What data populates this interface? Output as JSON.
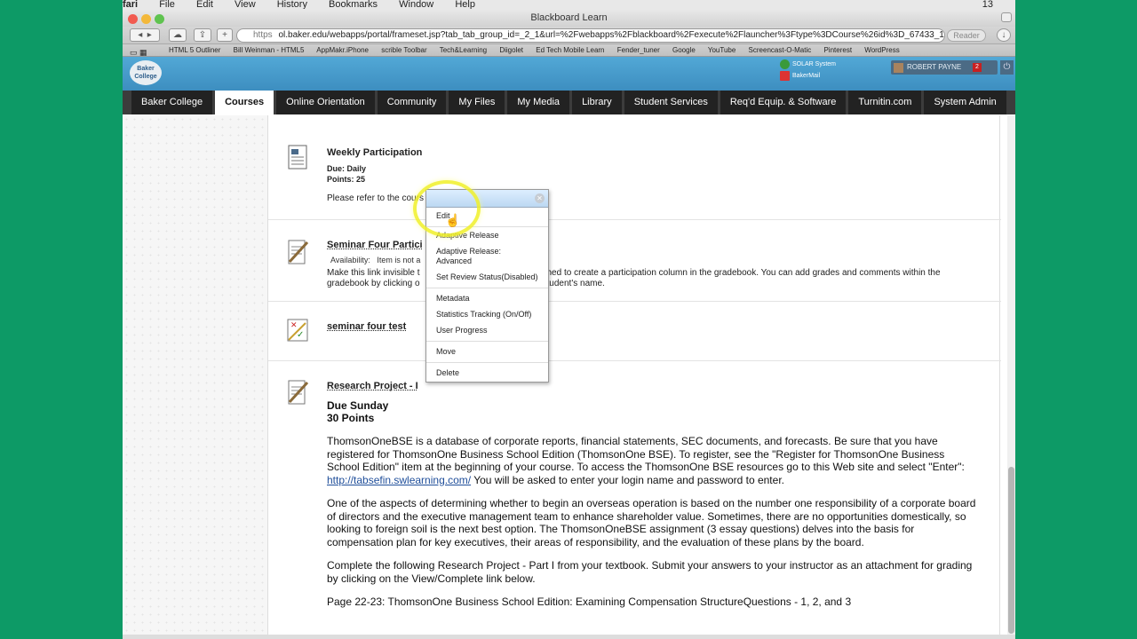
{
  "os_menu": [
    "fari",
    "File",
    "Edit",
    "View",
    "History",
    "Bookmarks",
    "Window",
    "Help"
  ],
  "os_clock": "13",
  "window": {
    "title": "Blackboard Learn"
  },
  "browser": {
    "https_label": "https",
    "url": "ol.baker.edu/webapps/portal/frameset.jsp?tab_tab_group_id=_2_1&url=%2Fwebapps%2Fblackboard%2Fexecute%2Flauncher%3Ftype%3DCourse%26id%3D_67433_1%26url",
    "reader_label": "Reader",
    "bookmarks": [
      "HTML 5 Outliner",
      "Bill Weinman - HTML5",
      "AppMakr.iPhone",
      "scrible Toolbar",
      "Tech&Learning",
      "Diigolet",
      "Ed Tech Mobile Learn",
      "Fender_tuner",
      "Google",
      "YouTube",
      "Screencast-O-Matic",
      "Pinterest",
      "WordPress"
    ]
  },
  "header": {
    "logo_text": "Baker College",
    "link1": "SOLAR System",
    "link2": "BakerMail",
    "user_name": "ROBERT PAYNE",
    "notification_count": "2"
  },
  "nav_tabs": [
    {
      "label": "Baker College",
      "active": false
    },
    {
      "label": "Courses",
      "active": true
    },
    {
      "label": "Online Orientation",
      "active": false
    },
    {
      "label": "Community",
      "active": false
    },
    {
      "label": "My Files",
      "active": false
    },
    {
      "label": "My Media",
      "active": false
    },
    {
      "label": "Library",
      "active": false
    },
    {
      "label": "Student Services",
      "active": false
    },
    {
      "label": "Req'd Equip. & Software",
      "active": false
    },
    {
      "label": "Turnitin.com",
      "active": false
    },
    {
      "label": "System Admin",
      "active": false
    }
  ],
  "items": {
    "weekly": {
      "title": "Weekly Participation",
      "due": "Due: Daily",
      "points": "Points: 25",
      "desc": "Please refer to the cours"
    },
    "seminar": {
      "title": "Seminar Four Partici",
      "availability_label": "Availability:",
      "availability_value": "Item is not a",
      "desc_line1_a": "Make this link invisible t",
      "desc_line1_b": "shed to create a participation column in the gradebook.  You can add grades and comments within the",
      "desc_line2_a": "gradebook by clicking o",
      "desc_line2_b": "student's name."
    },
    "test": {
      "title": "seminar four test"
    },
    "research": {
      "title": "Research Project - I",
      "due": "Due Sunday",
      "points": "30 Points",
      "p1_a": "ThomsonOneBSE is a database of corporate reports, financial statements, SEC documents, and forecasts. Be sure that you have registered for ThomsonOne Business School Edition (ThomsonOne BSE). To register, see the \"Register for ThomsonOne Business School Edition\" item at the beginning of your course. To access the ThomsonOne BSE resources go to this Web site and select \"Enter\": ",
      "p1_link": "http://tabsefin.swlearning.com/",
      "p1_b": " You will be asked to enter your login name and password to enter.",
      "p2": "One of the aspects of determining whether to begin an overseas operation is based on the number one responsibility of a corporate board of directors and the executive management team to enhance shareholder value. Sometimes, there are no opportunities domestically, so looking to foreign soil is the next best option. The ThomsonOneBSE assignment (3 essay questions) delves into the basis for compensation plan for key executives, their areas of responsibility, and the evaluation of these plans by the board.",
      "p3": "Complete the following Research Project - Part I from your textbook. Submit your answers to your instructor as an attachment for grading by clicking on the View/Complete link below.",
      "p4": "Page 22-23: ThomsonOne Business School Edition: Examining Compensation StructureQuestions - 1, 2, and 3"
    }
  },
  "context_menu": {
    "edit": "Edit",
    "adaptive": "Adaptive Release",
    "adaptive_adv_1": "Adaptive Release:",
    "adaptive_adv_2": "Advanced",
    "review": "Set Review Status(Disabled)",
    "metadata": "Metadata",
    "stats": "Statistics Tracking (On/Off)",
    "progress": "User Progress",
    "move": "Move",
    "delete": "Delete"
  }
}
